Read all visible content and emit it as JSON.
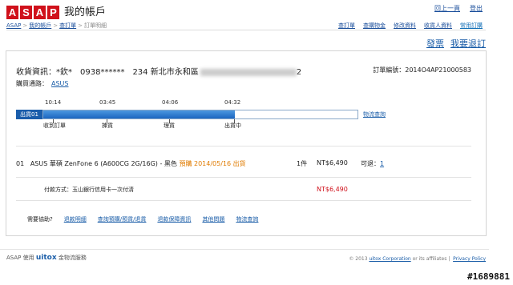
{
  "logo": {
    "letters": [
      "A",
      "S",
      "A",
      "P"
    ]
  },
  "header": {
    "title": "我的帳戶",
    "links": [
      "回上一頁",
      "登出"
    ]
  },
  "breadcrumb": [
    "ASAP",
    "我的帳戶",
    "查訂單",
    "訂單明細"
  ],
  "nav": [
    "查訂單",
    "查購物金",
    "修改資料",
    "收貨人資料",
    "常用訂購"
  ],
  "actions": {
    "invoice": "發票",
    "return": "我要退訂"
  },
  "order": {
    "recipient_prefix": "收貨資訊：*欽*　0938******　234 新北市永和區",
    "recipient_suffix": "2",
    "order_number_label": "訂單編號：",
    "order_number": "2014O4AP21000583",
    "store_label": "購買通路：",
    "store": "ASUS"
  },
  "timeline": {
    "label": "出貨01",
    "progress": 0.61,
    "link": "物流查詢",
    "times": [
      "10:14",
      "03:45",
      "04:06",
      "04:32"
    ],
    "steps": [
      "收到訂單",
      "揀貨",
      "理貨",
      "出貨中"
    ]
  },
  "item": {
    "index": "01",
    "name": "ASUS 華碩 ZenFone 6 (A600CG 2G/16G) - 黑色",
    "preorder_text": "預購 2014/05/16 出貨",
    "qty": "1件",
    "price": "NT$6,490",
    "returnable_label": "可退：",
    "returnable_value": "1"
  },
  "payment": {
    "text": "付款方式：玉山銀行信用卡一次付清",
    "total": "NT$6,490"
  },
  "help": {
    "label": "需要協助?",
    "links": [
      "退款明細",
      "查詢預購/預貨/退貨",
      "退款保障資訊",
      "其他問題",
      "物流查詢"
    ]
  },
  "footer": {
    "prefix": "ASAP 使用",
    "brand": "uitox",
    "suffix": "金物流服務",
    "copyright": "© 2013",
    "company": "uitox Corporation",
    "affiliates": "or its affiliates",
    "privacy": "Privacy Policy"
  },
  "watermark": "#1689881",
  "colors": {
    "brand_red": "#d0111b",
    "link_blue": "#1a5da8",
    "progress_blue": "#1b66bf"
  }
}
